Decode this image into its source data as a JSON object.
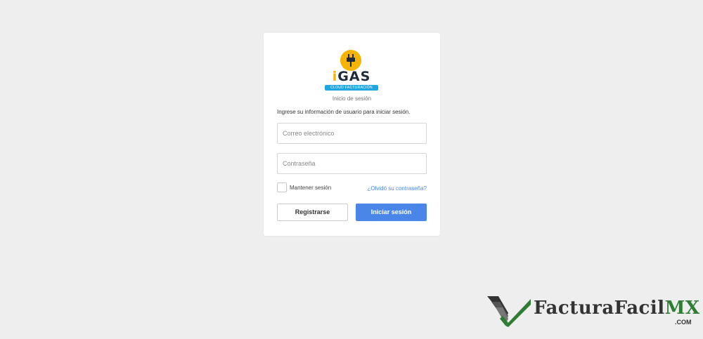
{
  "logo": {
    "word_i": "i",
    "word_rest": "GAS",
    "banner": "CLOUD FACTURACIÓN"
  },
  "login": {
    "subtitle": "Inicio de sesión",
    "instructions": "Ingrese su información de usuario para iniciar sesión.",
    "email": {
      "value": "",
      "placeholder": "Correo electrónico"
    },
    "password": {
      "value": "",
      "placeholder": "Contraseña"
    },
    "remember_label": "Mantener sesión",
    "remember_checked": false,
    "forgot_link": "¿Olvidó su contraseña?",
    "register_button": "Registrarse",
    "login_button": "Iniciar sesión"
  },
  "watermark": {
    "name": "FacturaFacil",
    "name_accent": "MX",
    "domain": ".COM"
  },
  "colors": {
    "background": "#eeeeee",
    "accent": "#4a86e8",
    "logo_yellow": "#f4b400",
    "logo_blue": "#1ea7e1",
    "watermark_green": "#2e7d32"
  },
  "icons": [
    "plug-icon",
    "checkmark-logo-icon"
  ]
}
